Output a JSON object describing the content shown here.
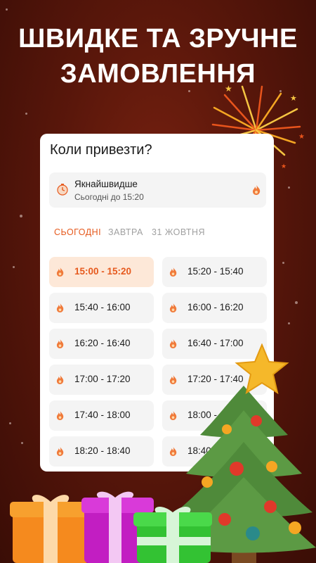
{
  "headline": {
    "line1": "ШВИДКЕ ТА ЗРУЧНЕ",
    "line2": "ЗАМОВЛЕННЯ"
  },
  "card": {
    "title": "Коли привезти?",
    "fastest": {
      "title": "Якнайшвидше",
      "subtitle": "Сьогодні до 15:20",
      "icon": "clock-icon"
    },
    "tabs": [
      {
        "label": "СЬОГОДНІ",
        "active": true
      },
      {
        "label": "ЗАВТРА",
        "active": false
      },
      {
        "label": "31 ЖОВТНЯ",
        "active": false
      }
    ],
    "slots": [
      {
        "time": "15:00 - 15:20",
        "selected": true
      },
      {
        "time": "15:20 - 15:40",
        "selected": false
      },
      {
        "time": "15:40 - 16:00",
        "selected": false
      },
      {
        "time": "16:00 - 16:20",
        "selected": false
      },
      {
        "time": "16:20 - 16:40",
        "selected": false
      },
      {
        "time": "16:40 - 17:00",
        "selected": false
      },
      {
        "time": "17:00 - 17:20",
        "selected": false
      },
      {
        "time": "17:20 - 17:40",
        "selected": false
      },
      {
        "time": "17:40 - 18:00",
        "selected": false
      },
      {
        "time": "18:00 - 18:20",
        "selected": false
      },
      {
        "time": "18:20 - 18:40",
        "selected": false
      },
      {
        "time": "18:40 - 19:00",
        "selected": false
      }
    ]
  },
  "colors": {
    "accent": "#e65a1e",
    "background": "#5a170b",
    "selected_bg": "#fde8d8"
  }
}
